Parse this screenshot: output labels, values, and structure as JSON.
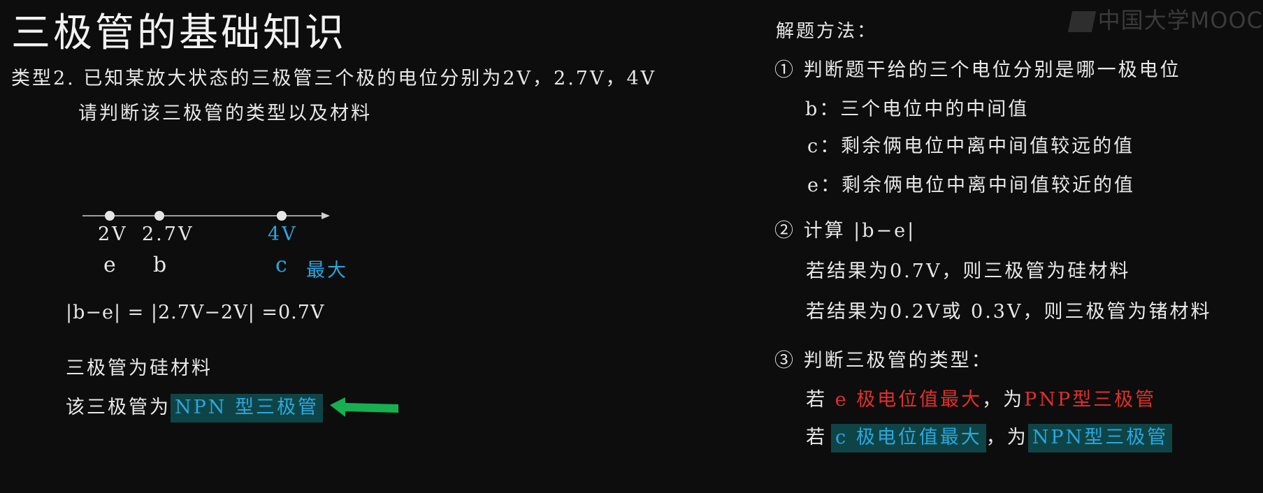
{
  "title": "三极管的基础知识",
  "logo": "中国大学MOOC",
  "problem": {
    "line1": "类型2. 已知某放大状态的三极管三个极的电位分别为2V，2.7V，4V",
    "line2": "请判断该三极管的类型以及材料"
  },
  "diagram": {
    "labels": [
      "2V",
      "2.7V",
      "4V"
    ],
    "poles": [
      "e",
      "b",
      "c"
    ],
    "max_note": "最大"
  },
  "solution": {
    "calc": "|b−e| = |2.7V−2V| =0.7V",
    "material": "三极管为硅材料",
    "type_prefix": "该三极管为",
    "type_result": "NPN 型三极管"
  },
  "method": {
    "heading": "解题方法：",
    "step1": "① 判断题干给的三个电位分别是哪一极电位",
    "b_rule": "b：三个电位中的中间值",
    "c_rule": "c：剩余俩电位中离中间值较远的值",
    "e_rule": "e：剩余俩电位中离中间值较近的值",
    "step2": "② 计算 |b−e|",
    "si_rule": "若结果为0.7V，则三极管为硅材料",
    "ge_rule": "若结果为0.2V或 0.3V，则三极管为锗材料",
    "step3": "③ 判断三极管的类型：",
    "pnp_prefix": "若",
    "pnp_cond": "e 极电位值最大",
    "pnp_mid": "，为",
    "pnp_type": "PNP型三极管",
    "npn_prefix": "若",
    "npn_cond": "c 极电位值最大",
    "npn_mid": "，为",
    "npn_type": "NPN型三极管"
  },
  "colors": {
    "background": "#0d0d0d",
    "highlight_blue": "#29a8e0",
    "highlight_red": "#e0302a",
    "highlight_box": "#0f4446",
    "arrow_green": "#16b050"
  }
}
